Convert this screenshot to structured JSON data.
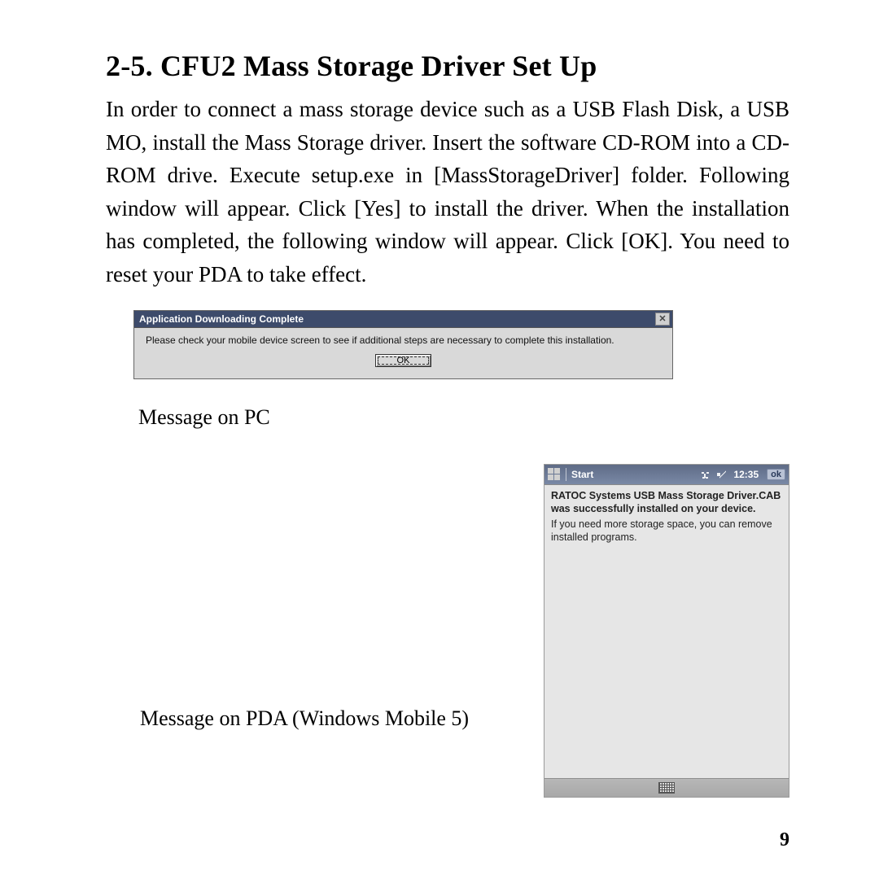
{
  "heading": "2-5. CFU2 Mass Storage Driver Set Up",
  "paragraph": "In order to connect a mass storage device such as a USB Flash Disk, a USB MO, install the Mass Storage driver. Insert the software CD-ROM into a CD-ROM drive. Execute setup.exe in [MassStorageDriver] folder. Following window will appear. Click [Yes] to install the driver. When the installation has completed, the following window will appear. Click [OK]. You need to reset your PDA to take effect.",
  "pc_dialog": {
    "title": "Application Downloading Complete",
    "message": "Please check your mobile device screen to see if additional steps are necessary to complete this installation.",
    "ok_label": "OK",
    "close_glyph": "✕"
  },
  "caption_pc": "Message on PC",
  "caption_pda": "Message on PDA (Windows Mobile 5)",
  "pda": {
    "start_label": "Start",
    "time": "12:35",
    "ok_label": "ok",
    "bold_message": "RATOC Systems USB Mass Storage Driver.CAB was successfully installed on your device.",
    "plain_message": "If you need more storage space, you can remove installed programs."
  },
  "page_number": "9"
}
